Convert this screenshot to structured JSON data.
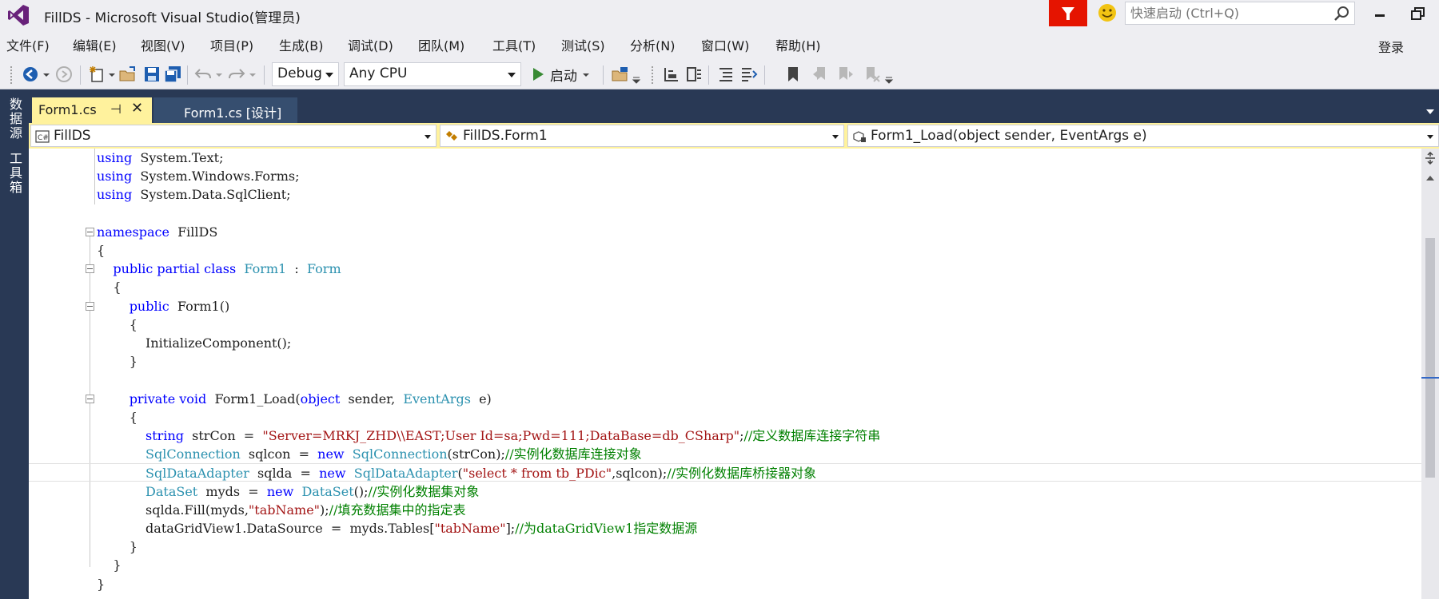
{
  "window": {
    "title": "FillDS - Microsoft Visual Studio(管理员)",
    "quick_launch_placeholder": "快速启动 (Ctrl+Q)"
  },
  "menu": {
    "items": [
      "文件(F)",
      "编辑(E)",
      "视图(V)",
      "项目(P)",
      "生成(B)",
      "调试(D)",
      "团队(M)",
      "工具(T)",
      "测试(S)",
      "分析(N)",
      "窗口(W)",
      "帮助(H)"
    ],
    "login": "登录"
  },
  "toolbar": {
    "configuration": "Debug",
    "platform": "Any CPU",
    "start_label": "启动"
  },
  "left_dock": {
    "tabs": [
      "数据源",
      "工具箱"
    ]
  },
  "tabs": [
    {
      "label": "Form1.cs",
      "active": true
    },
    {
      "label": "Form1.cs [设计]",
      "active": false
    }
  ],
  "navbar": {
    "project": "FillDS",
    "type": "FillDS.Form1",
    "member": "Form1_Load(object sender, EventArgs e)"
  },
  "colors": {
    "accent_tab": "#fff29d",
    "chrome_dark": "#293955",
    "keyword": "#0000ff",
    "type": "#2b91af",
    "string": "#a31515",
    "comment": "#008000"
  },
  "code": {
    "lines": [
      [
        [
          "kw",
          "using"
        ],
        [
          "",
          "  System.Text;"
        ]
      ],
      [
        [
          "kw",
          "using"
        ],
        [
          "",
          "  System.Windows.Forms;"
        ]
      ],
      [
        [
          "kw",
          "using"
        ],
        [
          "",
          "  System.Data.SqlClient;"
        ]
      ],
      [],
      [
        [
          "kw",
          "namespace"
        ],
        [
          "",
          "  FillDS"
        ]
      ],
      [
        [
          "",
          "{"
        ]
      ],
      [
        [
          "",
          "    "
        ],
        [
          "kw",
          "public partial class"
        ],
        [
          "",
          "  "
        ],
        [
          "ty",
          "Form1"
        ],
        [
          "",
          "  :  "
        ],
        [
          "ty",
          "Form"
        ]
      ],
      [
        [
          "",
          "    {"
        ]
      ],
      [
        [
          "",
          "        "
        ],
        [
          "kw",
          "public"
        ],
        [
          "",
          "  Form1()"
        ]
      ],
      [
        [
          "",
          "        {"
        ]
      ],
      [
        [
          "",
          "            InitializeComponent();"
        ]
      ],
      [
        [
          "",
          "        }"
        ]
      ],
      [],
      [
        [
          "",
          "        "
        ],
        [
          "kw",
          "private void"
        ],
        [
          "",
          "  Form1_Load("
        ],
        [
          "kw",
          "object"
        ],
        [
          "",
          "  sender,  "
        ],
        [
          "ty",
          "EventArgs"
        ],
        [
          "",
          "  e)"
        ]
      ],
      [
        [
          "",
          "        {"
        ]
      ],
      [
        [
          "",
          "            "
        ],
        [
          "kw",
          "string"
        ],
        [
          "",
          "  strCon  =  "
        ],
        [
          "st",
          "\"Server=MRKJ_ZHD\\\\EAST;User Id=sa;Pwd=111;DataBase=db_CSharp\""
        ],
        [
          "",
          ";"
        ],
        [
          "cm",
          "//定义数据库连接字符串"
        ]
      ],
      [
        [
          "",
          "            "
        ],
        [
          "ty",
          "SqlConnection"
        ],
        [
          "",
          "  sqlcon  =  "
        ],
        [
          "kw",
          "new"
        ],
        [
          "",
          "  "
        ],
        [
          "ty",
          "SqlConnection"
        ],
        [
          "",
          "(strCon);"
        ],
        [
          "cm",
          "//实例化数据库连接对象"
        ]
      ],
      [
        [
          "",
          "            "
        ],
        [
          "ty",
          "SqlDataAdapter"
        ],
        [
          "",
          "  sqlda  =  "
        ],
        [
          "kw",
          "new"
        ],
        [
          "",
          "  "
        ],
        [
          "ty",
          "SqlDataAdapter"
        ],
        [
          "",
          "("
        ],
        [
          "st",
          "\"select * from tb_PDic\""
        ],
        [
          "",
          ",sqlcon);"
        ],
        [
          "cm",
          "//实例化数据库桥接器对象"
        ]
      ],
      [
        [
          "",
          "            "
        ],
        [
          "ty",
          "DataSet"
        ],
        [
          "",
          "  myds  =  "
        ],
        [
          "kw",
          "new"
        ],
        [
          "",
          "  "
        ],
        [
          "ty",
          "DataSet"
        ],
        [
          "",
          "();"
        ],
        [
          "cm",
          "//实例化数据集对象"
        ]
      ],
      [
        [
          "",
          "            sqlda.Fill(myds,"
        ],
        [
          "st",
          "\"tabName\""
        ],
        [
          "",
          ");"
        ],
        [
          "cm",
          "//填充数据集中的指定表"
        ]
      ],
      [
        [
          "",
          "            dataGridView1.DataSource  =  myds.Tables["
        ],
        [
          "st",
          "\"tabName\""
        ],
        [
          "",
          "];"
        ],
        [
          "cm",
          "//为dataGridView1指定数据源"
        ]
      ],
      [
        [
          "",
          "        }"
        ]
      ],
      [
        [
          "",
          "    }"
        ]
      ],
      [
        [
          "",
          "}"
        ]
      ]
    ],
    "current_line": 17,
    "fold_lines": [
      4,
      6,
      8,
      13
    ]
  }
}
